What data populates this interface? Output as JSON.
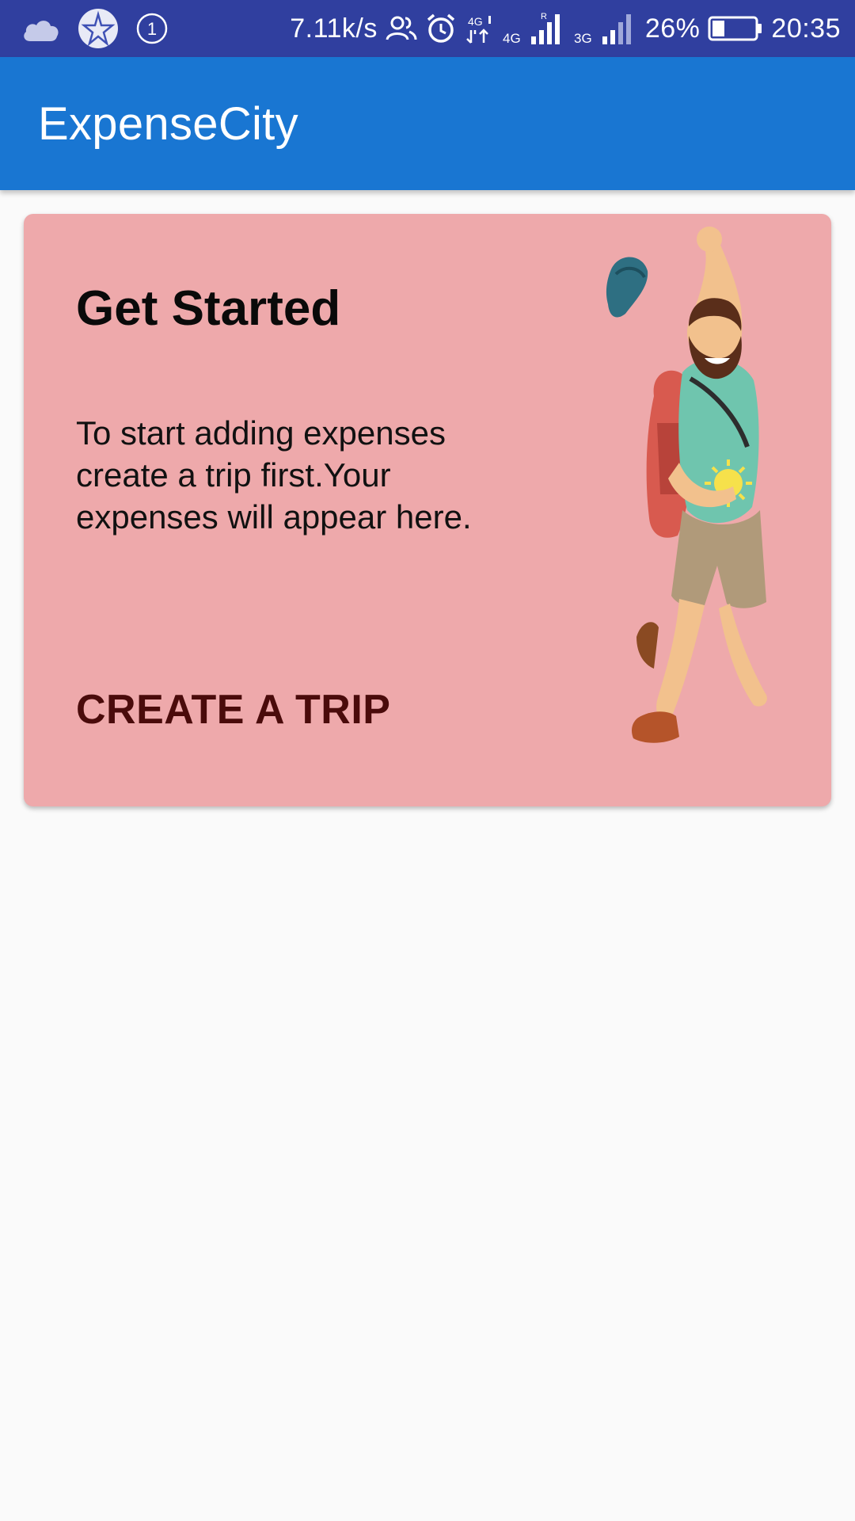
{
  "status_bar": {
    "notification_count": "1",
    "net_speed": "7.11k/s",
    "network_4g": "4G",
    "network_3g": "3G",
    "battery_percent": "26%",
    "time": "20:35",
    "icons": [
      "weather-cloud-icon",
      "app-star-icon",
      "notification-count-icon",
      "contacts-icon",
      "alarm-icon",
      "data-transfer-icon",
      "signal-4g-icon",
      "signal-3g-icon",
      "battery-icon"
    ]
  },
  "app_bar": {
    "title": "ExpenseCity",
    "color": "#1976d2"
  },
  "card": {
    "title": "Get Started",
    "body": "To start adding expenses create a trip first.Your expenses will appear here.",
    "action_label": "CREATE A TRIP",
    "illustration": "jumping-hiker-illustration",
    "background": "#eea9ab"
  }
}
